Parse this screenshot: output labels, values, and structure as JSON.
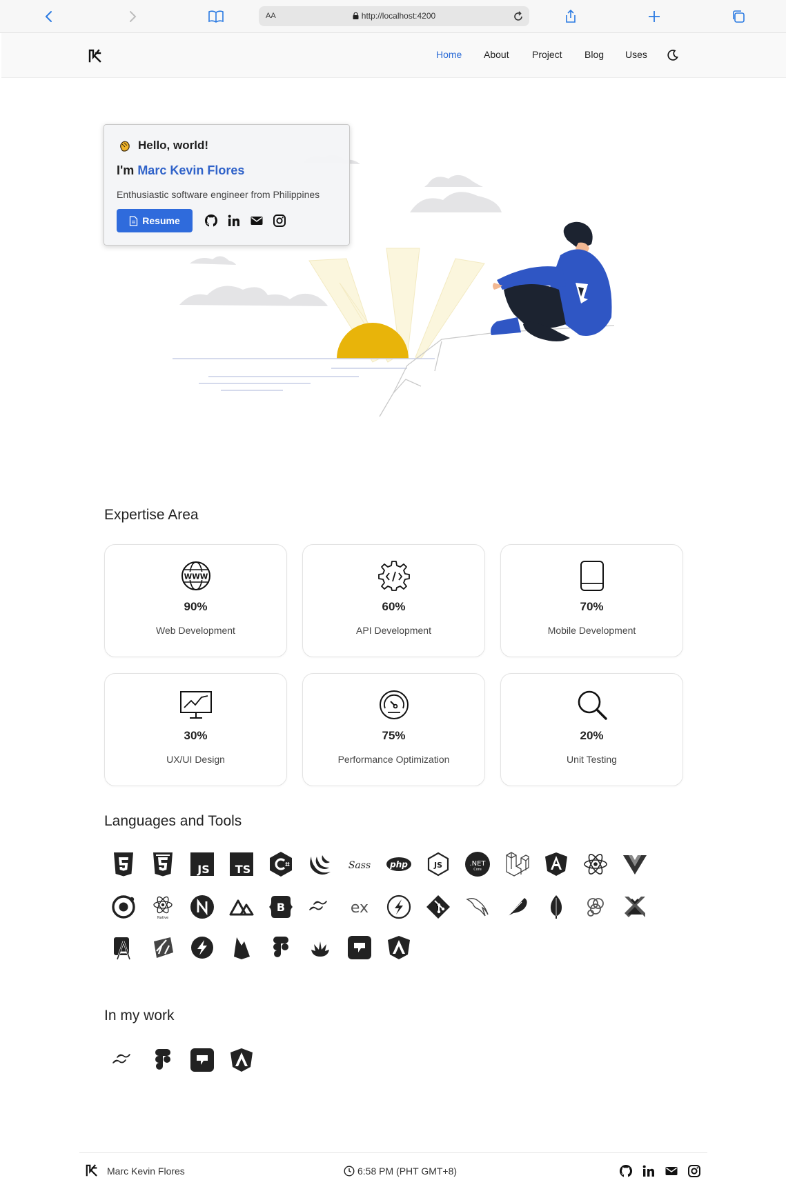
{
  "browser": {
    "text_size": "AA",
    "url": "http://localhost:4200",
    "icons": [
      "back-icon",
      "forward-icon",
      "reader-icon",
      "lock-icon",
      "reload-icon",
      "share-icon",
      "new-tab-icon",
      "tabs-icon"
    ]
  },
  "nav": {
    "links": [
      {
        "label": "Home",
        "active": true
      },
      {
        "label": "About"
      },
      {
        "label": "Project"
      },
      {
        "label": "Blog"
      },
      {
        "label": "Uses"
      }
    ],
    "theme_toggle_icon": "moon-icon"
  },
  "hero": {
    "greeting": "Hello, world!",
    "intro_prefix": "I'm",
    "name": "Marc Kevin Flores",
    "tagline": "Enthusiastic software engineer from Philippines",
    "resume_label": "Resume",
    "social_icons": [
      "github-icon",
      "linkedin-icon",
      "email-icon",
      "instagram-icon"
    ]
  },
  "expertise": {
    "title": "Expertise Area",
    "items": [
      {
        "icon": "www-icon",
        "percent": "90%",
        "label": "Web Development"
      },
      {
        "icon": "api-gear-icon",
        "percent": "60%",
        "label": "API Development"
      },
      {
        "icon": "mobile-icon",
        "percent": "70%",
        "label": "Mobile Development"
      },
      {
        "icon": "monitor-chart-icon",
        "percent": "30%",
        "label": "UX/UI Design"
      },
      {
        "icon": "speedometer-icon",
        "percent": "75%",
        "label": "Performance Optimization"
      },
      {
        "icon": "magnifier-icon",
        "percent": "20%",
        "label": "Unit Testing"
      }
    ]
  },
  "languages": {
    "title": "Languages and Tools",
    "icons": [
      "html5-icon",
      "css3-icon",
      "javascript-icon",
      "typescript-icon",
      "csharp-icon",
      "jquery-icon",
      "sass-icon",
      "php-icon",
      "nodejs-icon",
      "dotnet-core-icon",
      "laravel-icon",
      "angular-icon",
      "react-icon",
      "vue-icon",
      "ionic-icon",
      "react-native-icon",
      "nestjs-icon",
      "nuxt-icon",
      "bootstrap-icon",
      "tailwind-icon",
      "express-icon",
      "fastify-icon",
      "git-icon",
      "mysql-icon",
      "feather-icon",
      "mongodb-icon",
      "graphql-icon",
      "xamarin-icon",
      "android-studio-icon",
      "xcode-icon",
      "lightning-icon",
      "firebase-icon",
      "figma-icon",
      "jasmine-icon",
      "storybook-icon",
      "angular-material-icon"
    ],
    "text": {
      "javascript": "JS",
      "typescript": "TS",
      "dotnet": ".NET",
      "dotnet_sub": "Core",
      "express": "ex",
      "sass": "Sass",
      "php": "php",
      "react_native": "Native",
      "bootstrap": "B"
    }
  },
  "work": {
    "title": "In my work",
    "icons": [
      "tailwind-icon",
      "figma-icon",
      "storybook-icon",
      "angular-material-icon"
    ]
  },
  "footer": {
    "name": "Marc Kevin Flores",
    "time": "6:58 PM (PHT GMT+8)",
    "social_icons": [
      "github-icon",
      "linkedin-icon",
      "email-icon",
      "instagram-icon"
    ]
  },
  "colors": {
    "accent": "#2b6bd6",
    "resume_button": "#2f6bdc",
    "sun": "#e8b40a",
    "hoodie": "#2f56c4"
  }
}
